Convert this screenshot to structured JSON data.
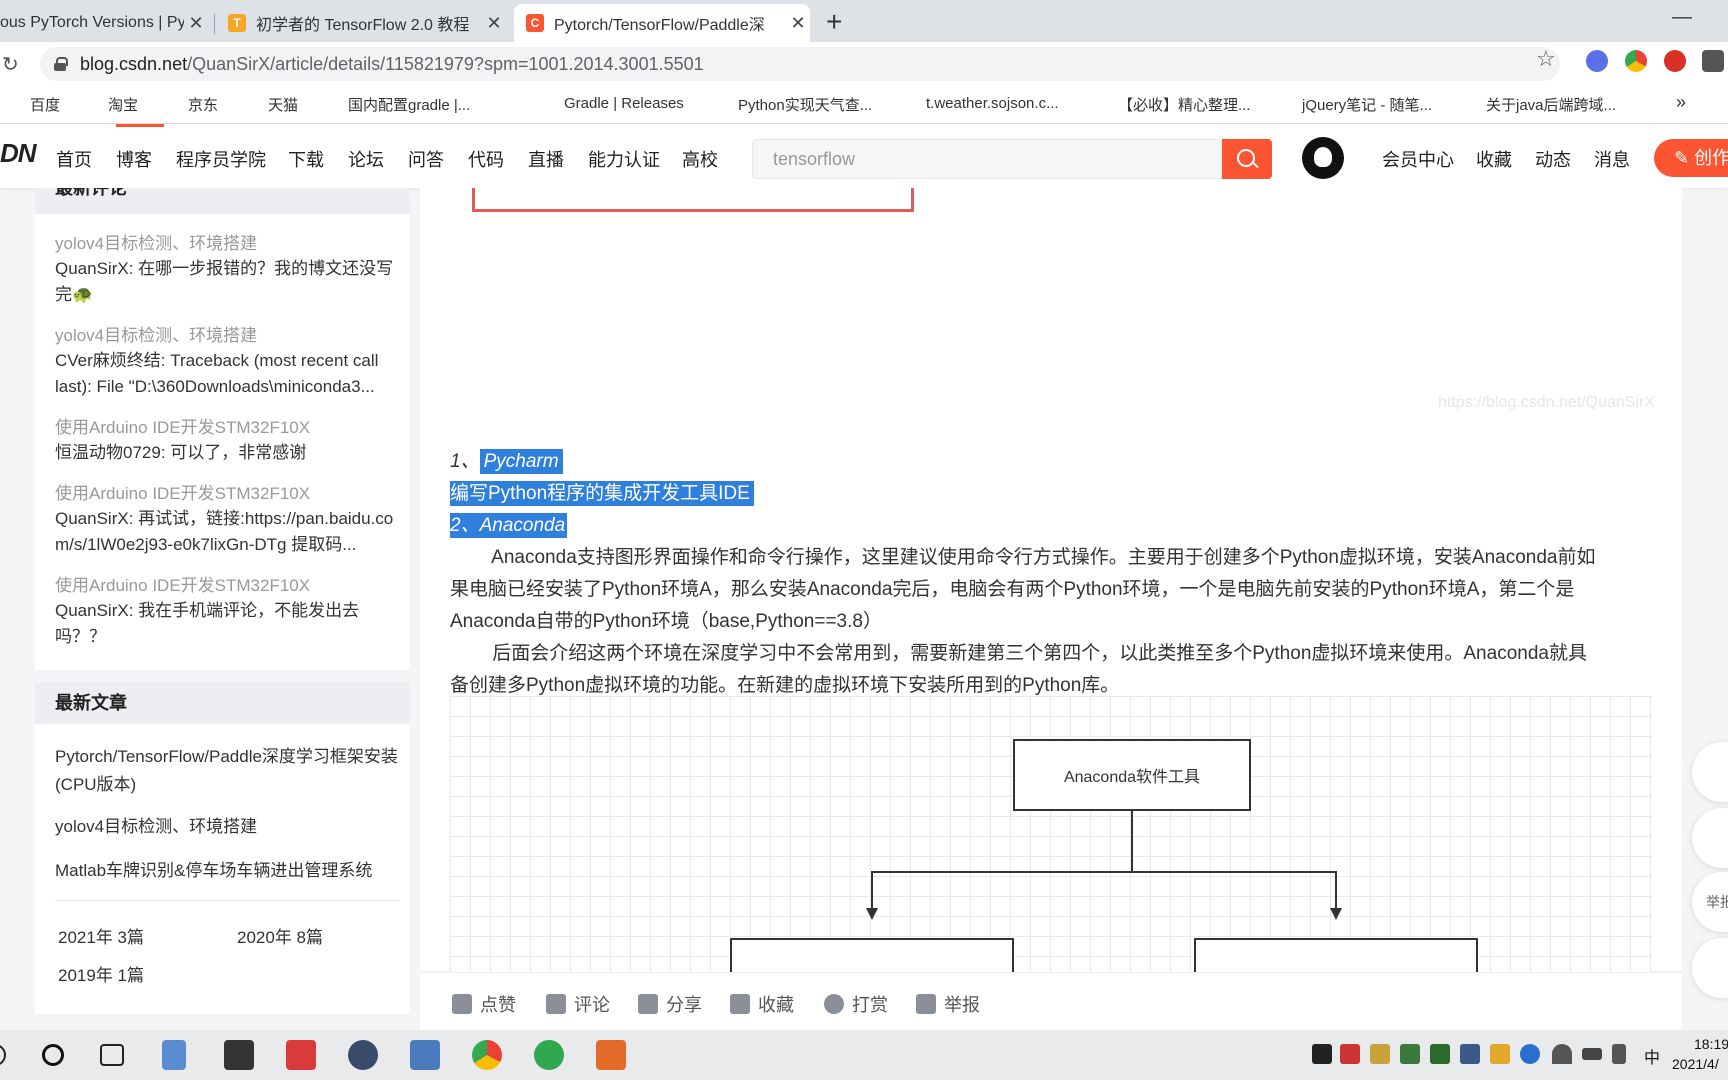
{
  "browser": {
    "tabs": [
      {
        "title": "ous PyTorch Versions | Py",
        "close": "✕"
      },
      {
        "title": "初学者的 TensorFlow 2.0 教程",
        "close": "✕"
      },
      {
        "title": "Pytorch/TensorFlow/Paddle深",
        "close": "✕"
      }
    ],
    "new_tab": "+",
    "minimize": "—",
    "url_host": "blog.csdn.net",
    "url_path": "/QuanSirX/article/details/115821979?spm=1001.2014.3001.5501",
    "star": "☆",
    "reload": "↻"
  },
  "bookmarks": [
    {
      "label": "百度",
      "color": "#2932e1"
    },
    {
      "label": "淘宝",
      "color": "#d81e06"
    },
    {
      "label": "京东",
      "color": "#e1251b"
    },
    {
      "label": "天猫",
      "color": "#d81e06"
    },
    {
      "label": "国内配置gradle |...",
      "color": "#f5a623"
    },
    {
      "label": "Gradle | Releases",
      "color": "#02303a"
    },
    {
      "label": "Python实现天气查...",
      "color": "#fc5531"
    },
    {
      "label": "t.weather.sojson.c...",
      "color": "#3cc9a5"
    },
    {
      "label": "【必收】精心整理...",
      "color": "#1aad19"
    },
    {
      "label": "jQuery笔记 - 随笔...",
      "color": "#555555"
    },
    {
      "label": "关于java后端跨域...",
      "color": "#fc5531"
    }
  ],
  "bookmarks_more": "»",
  "csdn": {
    "logo": "DN",
    "nav": [
      "首页",
      "博客",
      "程序员学院",
      "下载",
      "论坛",
      "问答",
      "代码",
      "直播",
      "能力认证",
      "高校"
    ],
    "search_value": "tensorflow",
    "right_nav": [
      "会员中心",
      "收藏",
      "动态",
      "消息"
    ],
    "create": "✎ 创作"
  },
  "sidebar": {
    "latest_comments_title": "最新评论",
    "comments": [
      {
        "article": "yolov4目标检测、环境搭建",
        "text": "QuanSirX: 在哪一步报错的？我的博文还没写完🐢"
      },
      {
        "article": "yolov4目标检测、环境搭建",
        "text": "CVer麻烦终结: Traceback (most recent call last): File \"D:\\360Downloads\\miniconda3..."
      },
      {
        "article": "使用Arduino IDE开发STM32F10X",
        "text": "恒温动物0729: 可以了，非常感谢"
      },
      {
        "article": "使用Arduino IDE开发STM32F10X",
        "text": "QuanSirX: 再试试，链接:https://pan.baidu.com/s/1lW0e2j93-e0k7lixGn-DTg 提取码..."
      },
      {
        "article": "使用Arduino IDE开发STM32F10X",
        "text": "QuanSirX: 我在手机端评论，不能发出去吗？？"
      }
    ],
    "latest_articles_title": "最新文章",
    "articles": [
      "Pytorch/TensorFlow/Paddle深度学习框架安装(CPU版本)",
      "yolov4目标检测、环境搭建",
      "Matlab车牌识别&停车场车辆进出管理系统"
    ],
    "archives": [
      "2021年  3篇",
      "2020年  8篇",
      "2019年  1篇"
    ]
  },
  "article": {
    "watermark": "https://blog.csdn.net/QuanSirX",
    "item1_prefix": "1、",
    "item1_name": "Pycharm",
    "item1_desc": "编写Python程序的集成开发工具IDE",
    "item2_prefix": "2、",
    "item2_name": "Anaconda",
    "para1_line1": "        Anaconda支持图形界面操作和命令行操作，这里建议使用命令行方式操作。主要用于创建多个Python虚拟环境，安装Anaconda前如",
    "para1_line2": "果电脑已经安装了Python环境A，那么安装Anaconda完后，电脑会有两个Python环境，一个是电脑先前安装的Python环境A，第二个是",
    "para1_line3": "Anaconda自带的Python环境（base,Python==3.8）",
    "para2_line1": "        后面会介绍这两个环境在深度学习中不会常用到，需要新建第三个第四个，以此类推至多个Python虚拟环境来使用。Anaconda就具",
    "para2_line2": "备创建多Python虚拟环境的功能。在新建的虚拟环境下安装所用到的Python库。",
    "diagram_root": "Anaconda软件工具"
  },
  "actions": [
    "点赞",
    "评论",
    "分享",
    "收藏",
    "打赏",
    "举报"
  ],
  "float_buttons": [
    "",
    "",
    "举报",
    ""
  ],
  "taskbar": {
    "ime": "中",
    "time": "18:19",
    "date": "2021/4/"
  }
}
